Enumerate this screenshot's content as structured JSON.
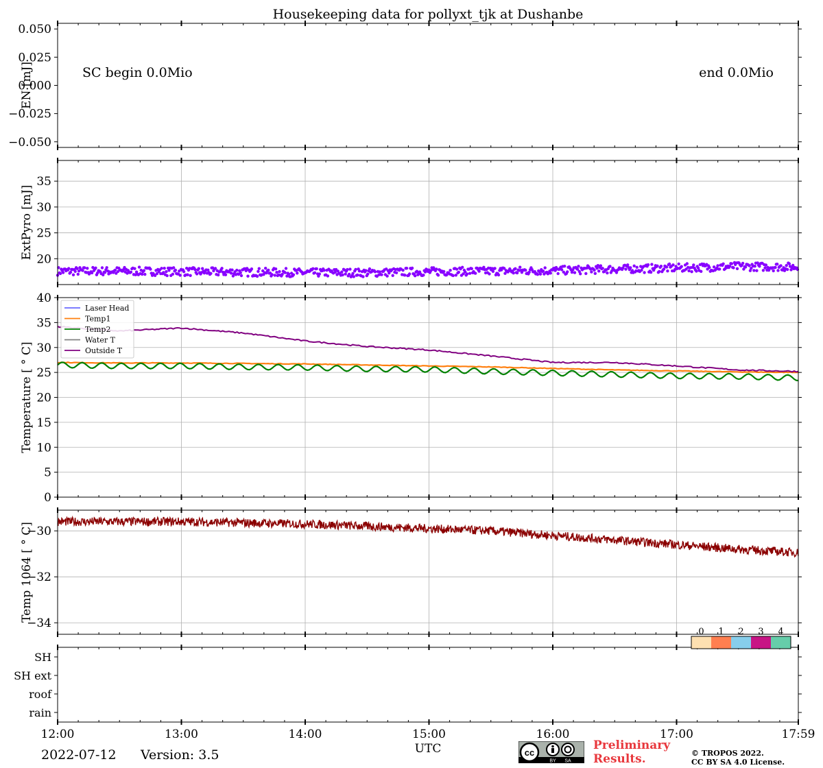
{
  "title": "Housekeeping data for pollyxt_tjk at Dushanbe",
  "footer": {
    "date": "2022-07-12",
    "version": "Version: 3.5",
    "preliminary_line1": "Preliminary",
    "preliminary_line2": "Results.",
    "copyright_line1": "© TROPOS 2022.",
    "copyright_line2": "CC BY SA 4.0 License.",
    "license_badge": "cc-by-sa-icon",
    "license_badge_labels": [
      "BY",
      "SA"
    ]
  },
  "colors": {
    "extpyro": "#8800ff",
    "laser_head": "#6a6aff",
    "temp1": "#ff7f0e",
    "temp2": "#008000",
    "water_t": "#808080",
    "outside_t": "#800080",
    "temp1064": "#8b0000",
    "preliminary": "#e8383d"
  },
  "chart_data": [
    {
      "type": "scatter",
      "panel": "energy",
      "ylabel": "EN [mJ]",
      "ylim": [
        -0.055,
        0.055
      ],
      "yticks": [
        "0.050",
        "0.025",
        "0.000",
        "−0.025",
        "−0.050"
      ],
      "yticks_values": [
        0.05,
        0.025,
        0,
        -0.025,
        -0.05
      ],
      "grid": false,
      "annotations": [
        "SC begin 0.0Mio",
        "end 0.0Mio"
      ],
      "series": []
    },
    {
      "type": "scatter",
      "panel": "extpyro",
      "ylabel": "ExtPyro [mJ]",
      "ylim": [
        15,
        39
      ],
      "yticks": [
        "20",
        "25",
        "30",
        "35"
      ],
      "yticks_values": [
        20,
        25,
        30,
        35
      ],
      "grid": true,
      "series": [
        {
          "x": [
            "12:00",
            "12:30",
            "13:00",
            "13:30",
            "14:00",
            "14:30",
            "15:00",
            "15:30",
            "16:00",
            "16:30",
            "17:00",
            "17:30",
            "17:59"
          ],
          "values": [
            17.6,
            17.6,
            17.5,
            17.4,
            17.3,
            17.3,
            17.5,
            17.6,
            17.7,
            18.0,
            18.2,
            18.5,
            18.4
          ]
        }
      ]
    },
    {
      "type": "line",
      "panel": "temperature",
      "ylabel": "Temperature [$^\\circ C$]",
      "ylim": [
        0,
        40
      ],
      "yticks": [
        "0",
        "5",
        "10",
        "15",
        "20",
        "25",
        "30",
        "35",
        "40"
      ],
      "yticks_values": [
        0,
        5,
        10,
        15,
        20,
        25,
        30,
        35,
        40
      ],
      "grid": true,
      "legend_position": "top-left",
      "x": [
        "12:00",
        "12:30",
        "13:00",
        "13:30",
        "14:00",
        "14:30",
        "15:00",
        "15:30",
        "16:00",
        "16:30",
        "17:00",
        "17:30",
        "17:59"
      ],
      "series": [
        {
          "name": "Laser Head",
          "values": []
        },
        {
          "name": "Temp1",
          "values": [
            27.0,
            26.9,
            26.9,
            26.8,
            26.7,
            26.5,
            26.3,
            26.1,
            25.8,
            25.5,
            25.3,
            25.1,
            25.0
          ]
        },
        {
          "name": "Temp2",
          "values": [
            26.5,
            26.3,
            26.3,
            26.1,
            26.0,
            25.7,
            25.6,
            25.2,
            24.9,
            24.6,
            24.3,
            24.2,
            23.9
          ]
        },
        {
          "name": "Water T",
          "values": []
        },
        {
          "name": "Outside T",
          "values": [
            34.2,
            33.3,
            33.9,
            32.9,
            31.3,
            30.2,
            29.5,
            28.3,
            27.0,
            27.0,
            26.3,
            25.5,
            25.2
          ]
        }
      ]
    },
    {
      "type": "line",
      "panel": "temp1064",
      "ylabel": "Temp 1064 [$^\\circ C$]",
      "ylim": [
        -34.5,
        -29.1
      ],
      "yticks": [
        "−30",
        "−32",
        "−34"
      ],
      "yticks_values": [
        -30,
        -32,
        -34
      ],
      "grid": true,
      "series": [
        {
          "x": [
            "12:00",
            "12:30",
            "13:00",
            "13:30",
            "14:00",
            "14:30",
            "15:00",
            "15:30",
            "16:00",
            "16:30",
            "17:00",
            "17:30",
            "17:59"
          ],
          "values": [
            -29.6,
            -29.6,
            -29.6,
            -29.65,
            -29.7,
            -29.8,
            -29.9,
            -30.0,
            -30.2,
            -30.4,
            -30.6,
            -30.8,
            -30.95
          ]
        }
      ]
    },
    {
      "type": "heatmap",
      "panel": "status",
      "yticks": [
        "SH",
        "SH ext",
        "roof",
        "rain"
      ],
      "xlabel": "UTC",
      "xticks": [
        "12:00",
        "13:00",
        "14:00",
        "15:00",
        "16:00",
        "17:00",
        "17:59"
      ],
      "colorbar": {
        "ticks": [
          "0",
          "1",
          "2",
          "3",
          "4"
        ],
        "colors": [
          "#fde0b1",
          "#ff7f50",
          "#87ceeb",
          "#c71585",
          "#66cdaa"
        ]
      },
      "series": []
    }
  ]
}
